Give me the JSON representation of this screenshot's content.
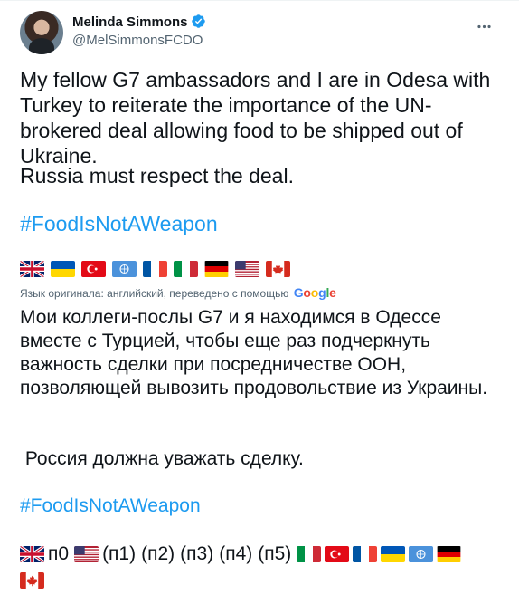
{
  "author": {
    "name": "Melinda Simmons",
    "handle": "@MelSimmonsFCDO",
    "verified": true
  },
  "tweet": {
    "line1": "My fellow G7 ambassadors and I are in Odesa with Turkey to reiterate the importance of the UN-brokered deal allowing food to be shipped out of Ukraine.",
    "line2": "Russia must respect the deal.",
    "hashtag": "#FoodIsNotAWeapon",
    "flags": [
      "uk",
      "ukraine",
      "turkey",
      "un",
      "france",
      "italy",
      "germany",
      "usa",
      "canada"
    ]
  },
  "translation": {
    "notice": "Язык оригинала: английский, переведено с помощью",
    "provider": "Google",
    "line1": "Мои коллеги-послы G7 и я находимся в Одессе вместе с Турцией, чтобы еще раз подчеркнуть важность сделки при посредничестве ООН, позволяющей вывозить продовольствие из Украины.",
    "line2": " Россия должна уважать сделку.",
    "hashtag": "#FoodIsNotAWeapon",
    "tail_labels": [
      "п0",
      "(п1)",
      "(п2)",
      "(п3)",
      "(п4)",
      "(п5)"
    ]
  },
  "colors": {
    "accent": "#1d9bf0",
    "text": "#0f1419",
    "muted": "#536471"
  }
}
